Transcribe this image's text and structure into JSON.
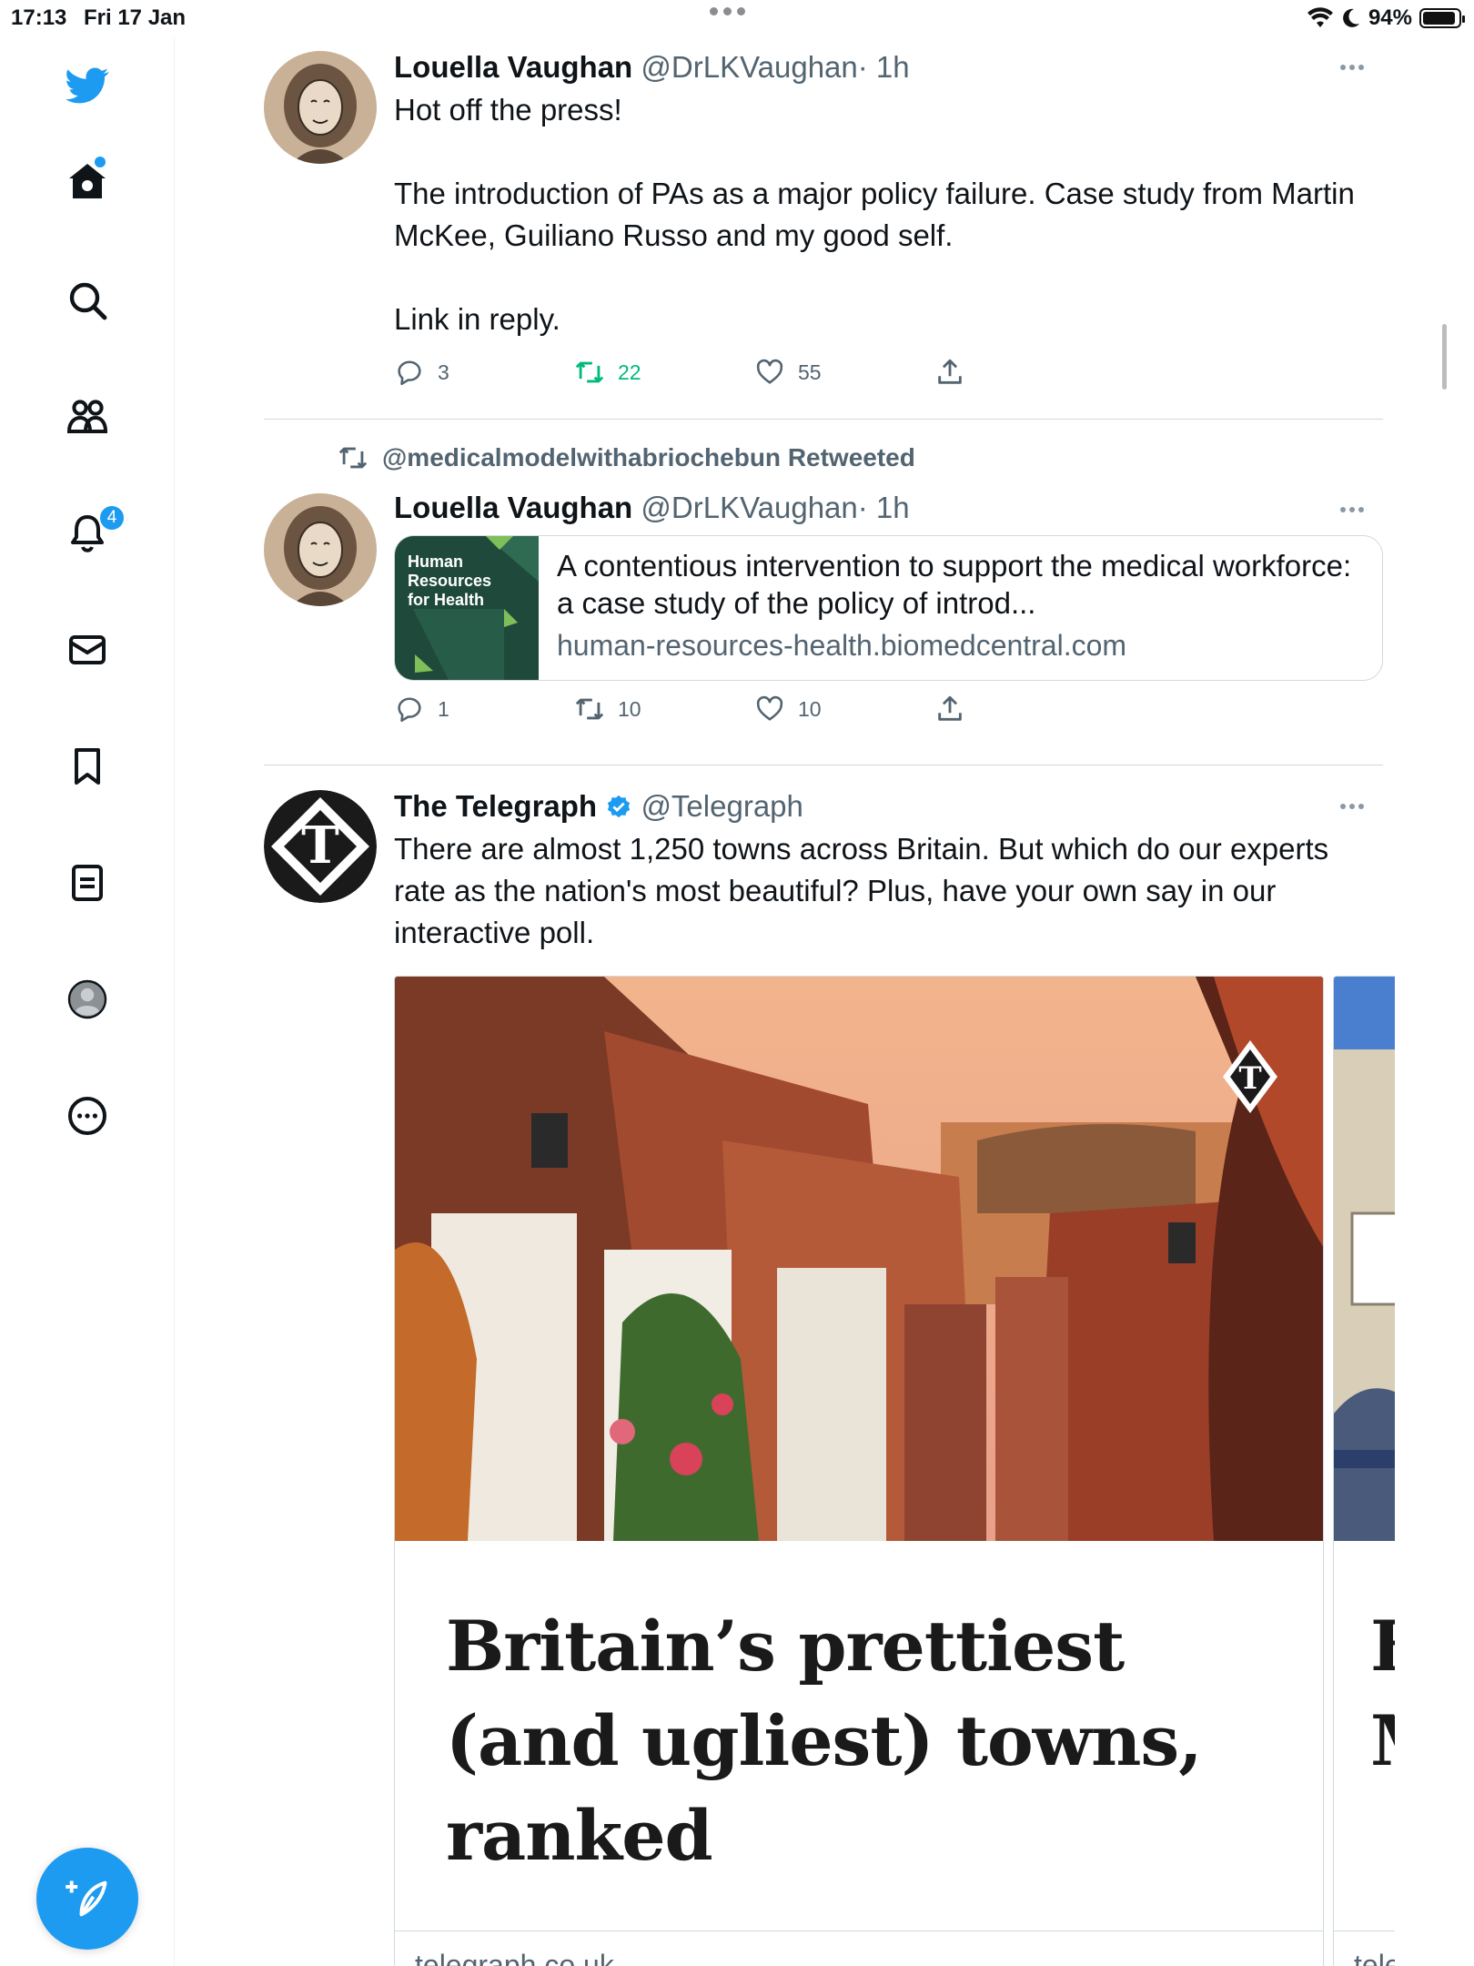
{
  "status_bar": {
    "time": "17:13",
    "date": "Fri 17 Jan",
    "battery": "94%",
    "battery_level": 0.94
  },
  "sidebar": {
    "items": [
      {
        "name": "twitter-logo",
        "icon": "bird-icon"
      },
      {
        "name": "home",
        "icon": "home-icon",
        "has_dot": true
      },
      {
        "name": "explore",
        "icon": "search-icon"
      },
      {
        "name": "communities",
        "icon": "people-icon"
      },
      {
        "name": "notifications",
        "icon": "bell-icon",
        "badge": "4"
      },
      {
        "name": "messages",
        "icon": "envelope-icon"
      },
      {
        "name": "bookmarks",
        "icon": "bookmark-icon"
      },
      {
        "name": "lists",
        "icon": "list-icon"
      },
      {
        "name": "profile",
        "icon": "profile-icon"
      },
      {
        "name": "more",
        "icon": "more-circle-icon"
      }
    ],
    "compose_icon": "feather-plus-icon"
  },
  "tweets": [
    {
      "author": "Louella Vaughan",
      "handle": "@DrLKVaughan",
      "time": "· 1h",
      "text": "Hot off the press!\n\nThe introduction of PAs as a major policy failure. Case study from Martin McKee, Guiliano Russo and my good self.\n\nLink in reply.",
      "replies": "3",
      "retweets": "22",
      "likes": "55"
    },
    {
      "retweeted_by": "@medicalmodelwithabriochebun Retweeted",
      "author": "Louella Vaughan",
      "handle": "@DrLKVaughan",
      "time": "· 1h",
      "card": {
        "thumb_text": "Human\nResources\nfor Health",
        "title": "A contentious intervention to support the medical workforce: a case study of the policy of introd...",
        "domain": "human-resources-health.biomedcentral.com"
      },
      "replies": "1",
      "retweets": "10",
      "likes": "10"
    },
    {
      "author": "The Telegraph",
      "handle": "@Telegraph",
      "verified": true,
      "text": "There are almost 1,250 towns across Britain. But which do our experts rate as the nation's most beautiful? Plus, have your own say in our interactive poll.",
      "cards": [
        {
          "headline": "Britain’s prettiest (and ugliest) towns, ranked",
          "domain": "telegraph.co.uk"
        },
        {
          "headline": "F\nM",
          "domain": "teleg"
        }
      ]
    }
  ],
  "colors": {
    "accent": "#1d9bf0",
    "retweet_active": "#00ba7c",
    "text_secondary": "#536471"
  }
}
